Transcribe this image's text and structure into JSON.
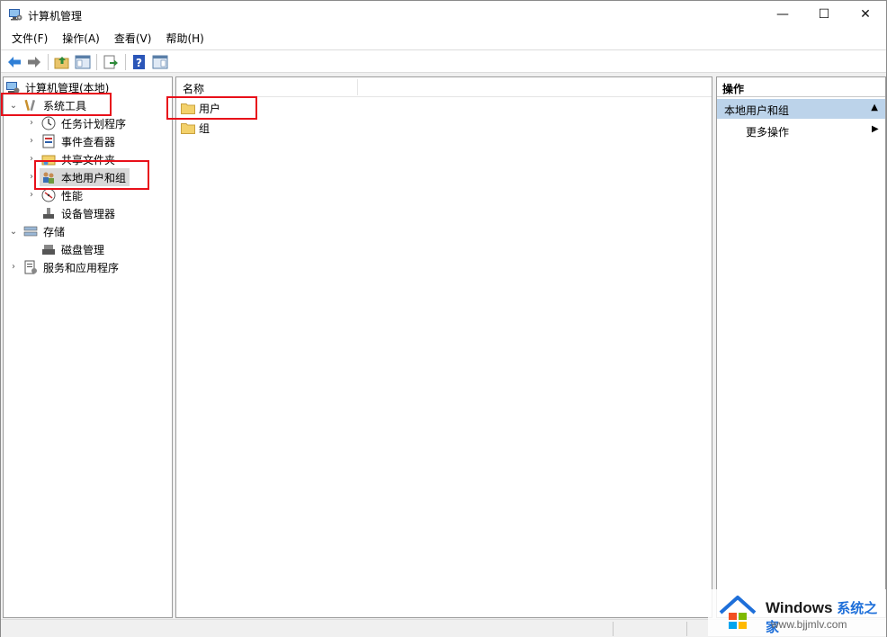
{
  "window": {
    "title": "计算机管理",
    "controls": {
      "minimize": "—",
      "maximize": "☐",
      "close": "✕"
    }
  },
  "menu": [
    "文件(F)",
    "操作(A)",
    "查看(V)",
    "帮助(H)"
  ],
  "toolbar": {
    "buttons": [
      "back-icon",
      "forward-icon",
      "up-folder-icon",
      "show-hide-tree-icon",
      "export-list-icon",
      "help-icon",
      "properties-icon"
    ]
  },
  "tree": {
    "root": "计算机管理(本地)",
    "system_tools": "系统工具",
    "task_scheduler": "任务计划程序",
    "event_viewer": "事件查看器",
    "shared_folders": "共享文件夹",
    "local_users_groups": "本地用户和组",
    "performance": "性能",
    "device_manager": "设备管理器",
    "storage": "存储",
    "disk_management": "磁盘管理",
    "services_apps": "服务和应用程序"
  },
  "list": {
    "column_name": "名称",
    "items": [
      "用户",
      "组"
    ]
  },
  "actions": {
    "header": "操作",
    "group": "本地用户和组",
    "group_arrow": "▲",
    "more": "更多操作",
    "more_arrow": "▶"
  },
  "watermark": {
    "brand": "Windows",
    "brand_suffix": "系统之家",
    "url": "www.bjjmlv.com"
  },
  "colors": {
    "highlight_box": "#e8101a",
    "actions_group_bg": "#bcd3ea",
    "folder": "#f3d16b"
  }
}
